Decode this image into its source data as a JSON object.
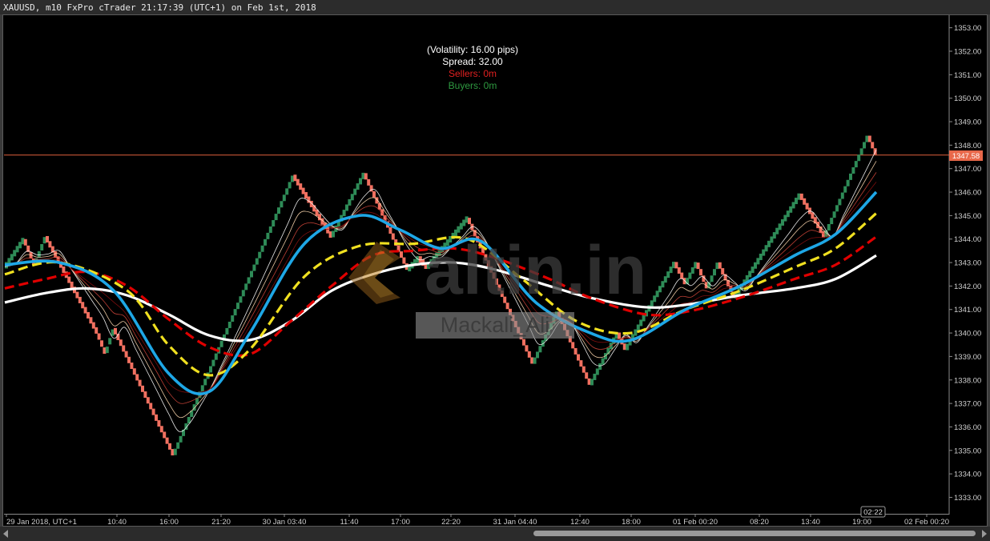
{
  "window": {
    "title": "XAUUSD, m10 FxPro cTrader 21:17:39 (UTC+1) on Feb 1st, 2018"
  },
  "info_box": {
    "volatility": "(Volatility: 16.00 pips)",
    "spread": "Spread: 32.00",
    "sellers": "Sellers: 0m",
    "buyers": "Buyers: 0m"
  },
  "watermark": {
    "logo_text": "altin.in",
    "user_text": "Mackali_Ali"
  },
  "price_label": "1347.58",
  "countdown": "02:22",
  "colors": {
    "background": "#000000",
    "bull_brick": "#2e8b57",
    "bear_brick": "#f07060",
    "current_price_line": "#e0603c",
    "ma_fast": "#1ea7e6",
    "ma_yellow": "#f0e020",
    "ma_red": "#e00000",
    "ma_slow": "#ffffff",
    "sellers_text": "#e02020",
    "buyers_text": "#2e9a40"
  },
  "chart_data": {
    "type": "line",
    "title": "",
    "ylim": [
      1332.3,
      1353.5
    ],
    "y_ticks": [
      1333.0,
      1334.0,
      1335.0,
      1336.0,
      1337.0,
      1338.0,
      1339.0,
      1340.0,
      1341.0,
      1342.0,
      1343.0,
      1344.0,
      1345.0,
      1346.0,
      1347.0,
      1348.0,
      1349.0,
      1350.0,
      1351.0,
      1352.0,
      1353.0
    ],
    "x_tick_labels": [
      "29 Jan 2018, UTC+1",
      "10:40",
      "16:00",
      "21:20",
      "30 Jan 03:40",
      "11:40",
      "17:00",
      "22:20",
      "31 Jan 04:40",
      "12:40",
      "18:00",
      "01 Feb 00:20",
      "08:20",
      "13:40",
      "19:00",
      "02 Feb 00:20"
    ],
    "current_price": 1347.58,
    "renko_path": [
      {
        "i": 0,
        "price": 1342.8
      },
      {
        "i": 7,
        "price": 1344.0
      },
      {
        "i": 11,
        "price": 1342.9
      },
      {
        "i": 15,
        "price": 1344.1
      },
      {
        "i": 34,
        "price": 1340.0
      },
      {
        "i": 37,
        "price": 1339.1
      },
      {
        "i": 40,
        "price": 1340.2
      },
      {
        "i": 62,
        "price": 1334.8
      },
      {
        "i": 106,
        "price": 1346.7
      },
      {
        "i": 120,
        "price": 1344.1
      },
      {
        "i": 132,
        "price": 1346.8
      },
      {
        "i": 148,
        "price": 1342.7
      },
      {
        "i": 152,
        "price": 1343.2
      },
      {
        "i": 155,
        "price": 1342.8
      },
      {
        "i": 170,
        "price": 1344.9
      },
      {
        "i": 194,
        "price": 1338.7
      },
      {
        "i": 203,
        "price": 1340.9
      },
      {
        "i": 215,
        "price": 1337.8
      },
      {
        "i": 225,
        "price": 1340.0
      },
      {
        "i": 228,
        "price": 1339.3
      },
      {
        "i": 246,
        "price": 1343.0
      },
      {
        "i": 250,
        "price": 1342.1
      },
      {
        "i": 254,
        "price": 1343.0
      },
      {
        "i": 258,
        "price": 1341.9
      },
      {
        "i": 262,
        "price": 1343.0
      },
      {
        "i": 268,
        "price": 1341.5
      },
      {
        "i": 292,
        "price": 1345.9
      },
      {
        "i": 301,
        "price": 1344.1
      },
      {
        "i": 317,
        "price": 1348.4
      },
      {
        "i": 320,
        "price": 1347.6
      }
    ],
    "series": [
      {
        "type": "ma",
        "points": [
          [
            0,
            1342.9
          ],
          [
            20,
            1343.0
          ],
          [
            40,
            1341.8
          ],
          [
            60,
            1338.3
          ],
          [
            75,
            1337.5
          ],
          [
            90,
            1340.0
          ],
          [
            110,
            1343.8
          ],
          [
            130,
            1345.0
          ],
          [
            145,
            1344.4
          ],
          [
            160,
            1343.6
          ],
          [
            175,
            1343.9
          ],
          [
            195,
            1341.3
          ],
          [
            215,
            1340.0
          ],
          [
            230,
            1339.7
          ],
          [
            250,
            1341.0
          ],
          [
            270,
            1342.0
          ],
          [
            290,
            1343.3
          ],
          [
            305,
            1344.2
          ],
          [
            320,
            1346.0
          ]
        ]
      },
      {
        "type": "ma",
        "points": [
          [
            0,
            1342.5
          ],
          [
            20,
            1343.0
          ],
          [
            45,
            1341.8
          ],
          [
            60,
            1339.5
          ],
          [
            75,
            1338.2
          ],
          [
            90,
            1339.3
          ],
          [
            110,
            1342.4
          ],
          [
            130,
            1343.7
          ],
          [
            150,
            1343.8
          ],
          [
            170,
            1344.0
          ],
          [
            190,
            1342.3
          ],
          [
            210,
            1340.5
          ],
          [
            230,
            1340.0
          ],
          [
            250,
            1341.0
          ],
          [
            270,
            1341.8
          ],
          [
            290,
            1342.8
          ],
          [
            305,
            1343.6
          ],
          [
            320,
            1345.1
          ]
        ]
      },
      {
        "type": "ma",
        "points": [
          [
            0,
            1341.9
          ],
          [
            15,
            1342.3
          ],
          [
            30,
            1342.6
          ],
          [
            45,
            1342.0
          ],
          [
            60,
            1340.6
          ],
          [
            75,
            1339.4
          ],
          [
            90,
            1339.1
          ],
          [
            105,
            1340.5
          ],
          [
            120,
            1342.0
          ],
          [
            135,
            1343.3
          ],
          [
            150,
            1343.5
          ],
          [
            165,
            1343.6
          ],
          [
            180,
            1343.2
          ],
          [
            200,
            1342.3
          ],
          [
            215,
            1341.5
          ],
          [
            235,
            1340.8
          ],
          [
            250,
            1340.9
          ],
          [
            270,
            1341.5
          ],
          [
            290,
            1342.3
          ],
          [
            305,
            1342.9
          ],
          [
            320,
            1344.1
          ]
        ]
      },
      {
        "type": "ma",
        "points": [
          [
            0,
            1341.3
          ],
          [
            15,
            1341.7
          ],
          [
            30,
            1341.9
          ],
          [
            45,
            1341.6
          ],
          [
            60,
            1340.8
          ],
          [
            75,
            1339.9
          ],
          [
            90,
            1339.7
          ],
          [
            105,
            1340.5
          ],
          [
            120,
            1341.8
          ],
          [
            135,
            1342.5
          ],
          [
            150,
            1342.9
          ],
          [
            165,
            1343.0
          ],
          [
            180,
            1342.7
          ],
          [
            200,
            1342.0
          ],
          [
            215,
            1341.5
          ],
          [
            235,
            1341.1
          ],
          [
            250,
            1341.2
          ],
          [
            270,
            1341.6
          ],
          [
            290,
            1341.9
          ],
          [
            305,
            1342.3
          ],
          [
            320,
            1343.3
          ]
        ]
      }
    ]
  }
}
